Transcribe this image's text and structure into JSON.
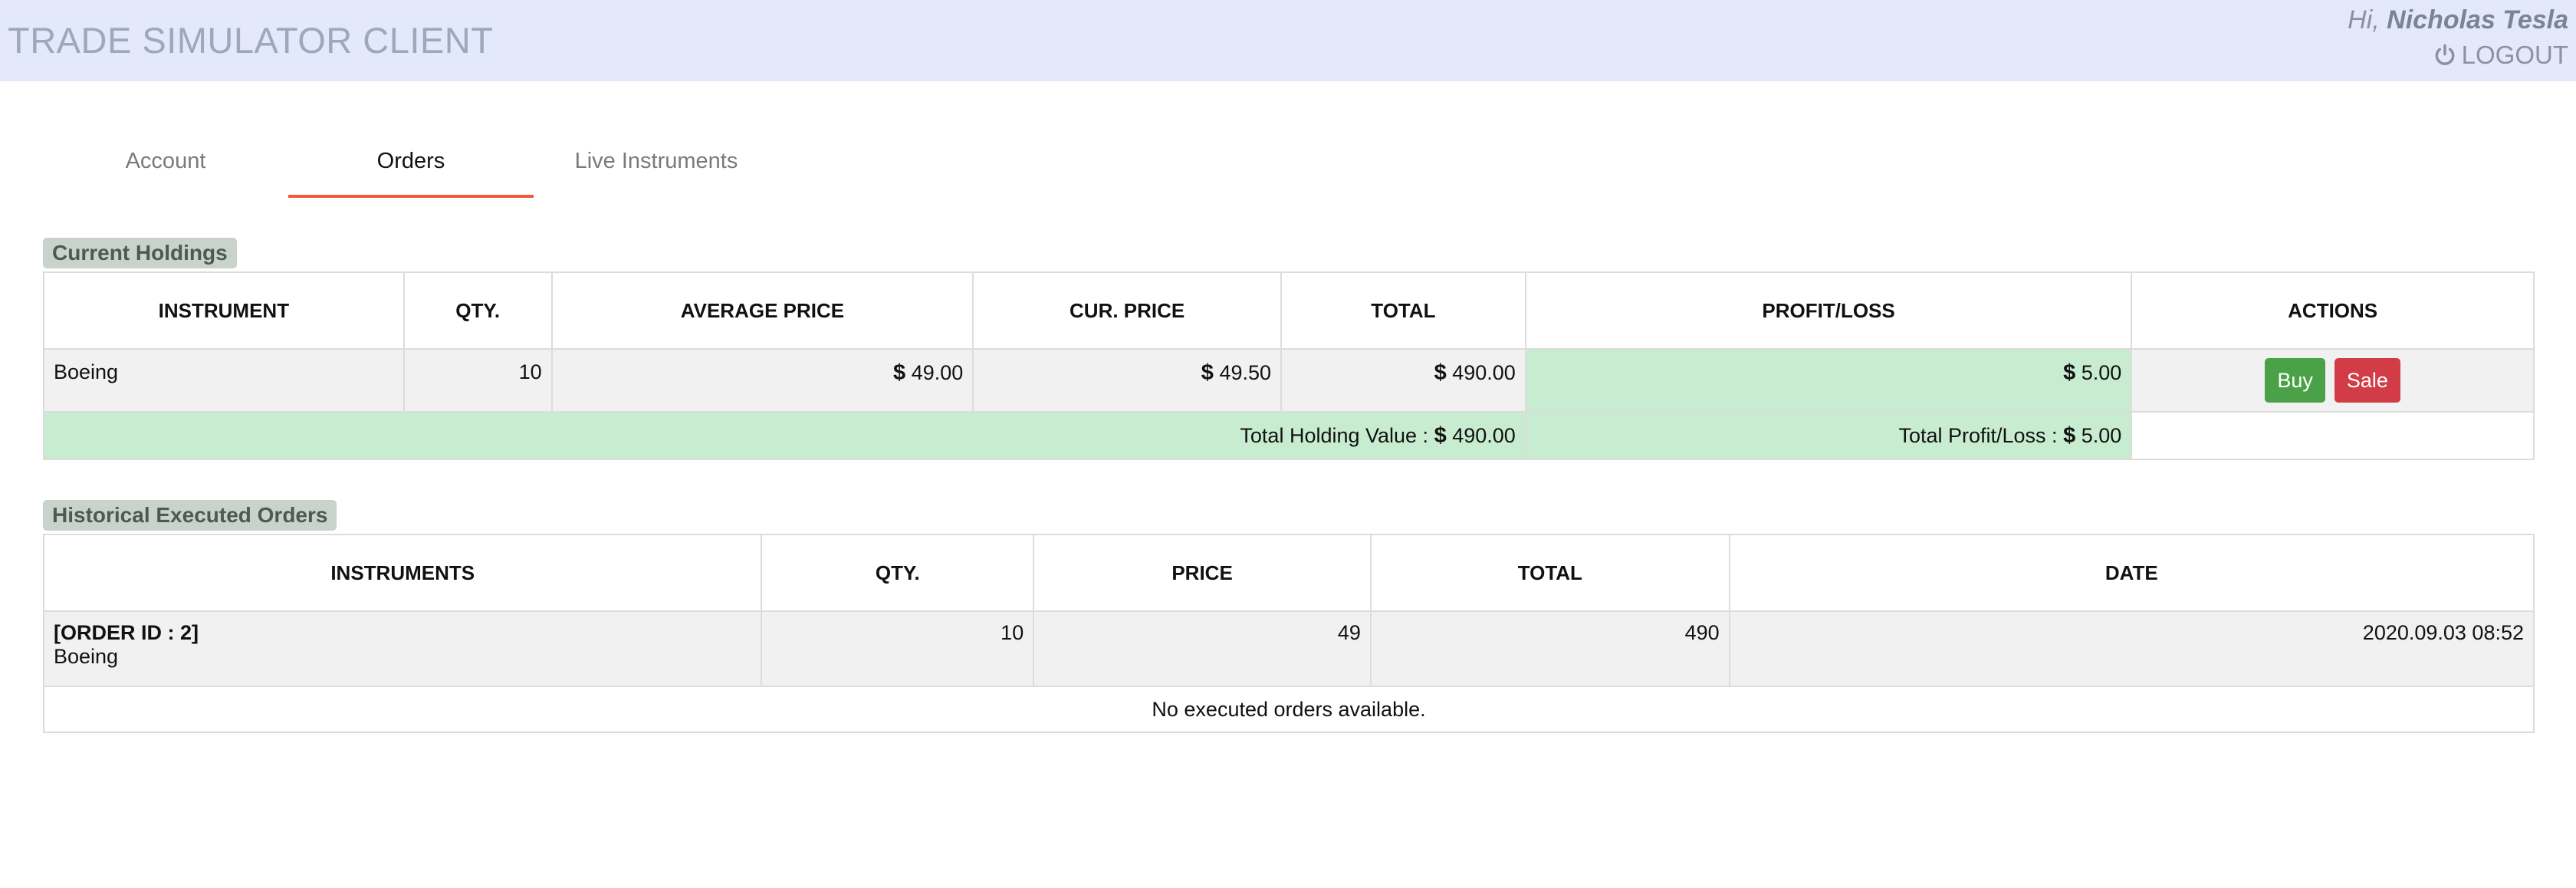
{
  "header": {
    "app_title": "TRADE SIMULATOR CLIENT",
    "greeting_prefix": "Hi,",
    "user_name": "Nicholas Tesla",
    "logout_label": "LOGOUT"
  },
  "tabs": [
    {
      "label": "Account",
      "active": false
    },
    {
      "label": "Orders",
      "active": true
    },
    {
      "label": "Live Instruments",
      "active": false
    }
  ],
  "current_holdings": {
    "title": "Current Holdings",
    "columns": [
      "INSTRUMENT",
      "QTY.",
      "AVERAGE PRICE",
      "CUR. PRICE",
      "TOTAL",
      "PROFIT/LOSS",
      "ACTIONS"
    ],
    "currency_symbol": "$",
    "rows": [
      {
        "instrument": "Boeing",
        "qty": "10",
        "average_price": "49.00",
        "cur_price": "49.50",
        "total": "490.00",
        "profit_loss": "5.00",
        "buy_label": "Buy",
        "sale_label": "Sale"
      }
    ],
    "total_holding_value_label": "Total Holding Value :",
    "total_holding_value": "490.00",
    "total_profit_loss_label": "Total Profit/Loss :",
    "total_profit_loss": "5.00"
  },
  "historical_orders": {
    "title": "Historical Executed Orders",
    "columns": [
      "INSTRUMENTS",
      "QTY.",
      "PRICE",
      "TOTAL",
      "DATE"
    ],
    "rows": [
      {
        "order_id_label": "[ORDER ID : 2]",
        "instrument": "Boeing",
        "qty": "10",
        "price": "49",
        "total": "490",
        "date": "2020.09.03 08:52"
      }
    ],
    "empty_message": "No executed orders available."
  },
  "colors": {
    "header_bg": "#e3e8fa",
    "tab_active_underline": "#f05a3c",
    "profit_bg": "#c7ecd0",
    "buy_button": "#4aa147",
    "sale_button": "#d23c46"
  },
  "icons": {
    "logout": "power-icon"
  }
}
